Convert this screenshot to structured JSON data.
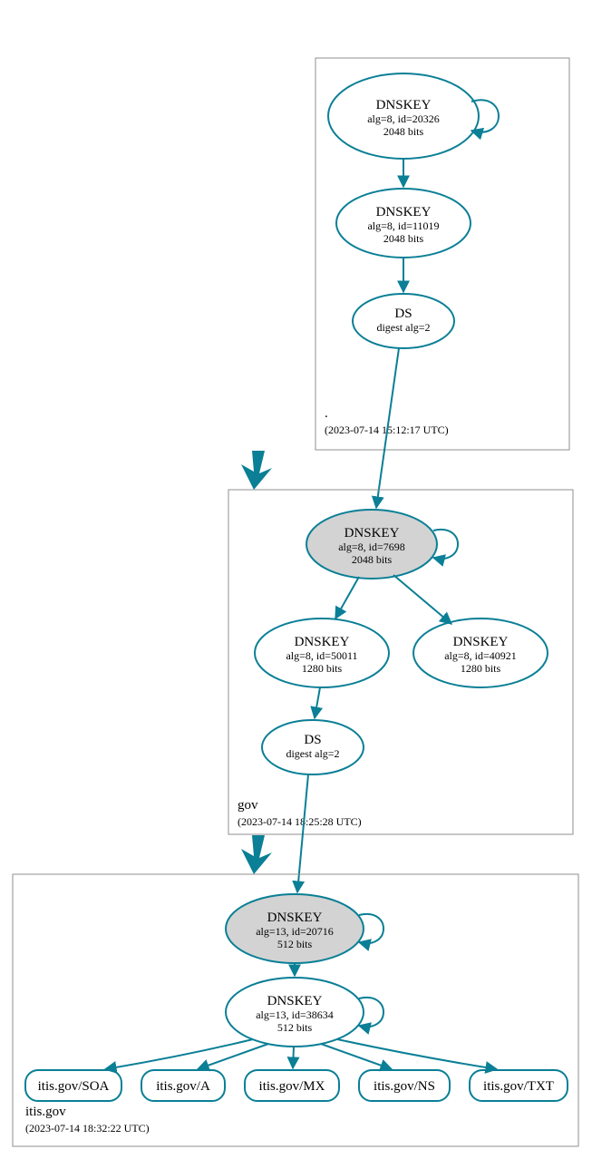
{
  "zones": {
    "root": {
      "name": ".",
      "timestamp": "(2023-07-14 15:12:17 UTC)"
    },
    "gov": {
      "name": "gov",
      "timestamp": "(2023-07-14 18:25:28 UTC)"
    },
    "itis": {
      "name": "itis.gov",
      "timestamp": "(2023-07-14 18:32:22 UTC)"
    }
  },
  "nodes": {
    "root_ksk": {
      "title": "DNSKEY",
      "l2": "alg=8, id=20326",
      "l3": "2048 bits"
    },
    "root_zsk": {
      "title": "DNSKEY",
      "l2": "alg=8, id=11019",
      "l3": "2048 bits"
    },
    "root_ds": {
      "title": "DS",
      "l2": "digest alg=2"
    },
    "gov_ksk": {
      "title": "DNSKEY",
      "l2": "alg=8, id=7698",
      "l3": "2048 bits"
    },
    "gov_zsk1": {
      "title": "DNSKEY",
      "l2": "alg=8, id=50011",
      "l3": "1280 bits"
    },
    "gov_zsk2": {
      "title": "DNSKEY",
      "l2": "alg=8, id=40921",
      "l3": "1280 bits"
    },
    "gov_ds": {
      "title": "DS",
      "l2": "digest alg=2"
    },
    "itis_ksk": {
      "title": "DNSKEY",
      "l2": "alg=13, id=20716",
      "l3": "512 bits"
    },
    "itis_zsk": {
      "title": "DNSKEY",
      "l2": "alg=13, id=38634",
      "l3": "512 bits"
    }
  },
  "rr": {
    "soa": "itis.gov/SOA",
    "a": "itis.gov/A",
    "mx": "itis.gov/MX",
    "ns": "itis.gov/NS",
    "txt": "itis.gov/TXT"
  }
}
